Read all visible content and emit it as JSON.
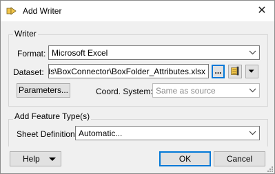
{
  "window": {
    "title": "Add Writer",
    "close_glyph": "✕"
  },
  "writer_group": {
    "label": "Writer",
    "format_label": "Format:",
    "format_value": "Microsoft Excel",
    "dataset_label": "Dataset:",
    "dataset_value": "oads\\BoxConnector\\BoxFolder_Attributes.xlsx",
    "browse_label": "...",
    "parameters_label": "Parameters...",
    "coord_label": "Coord. System:",
    "coord_value": "Same as source"
  },
  "feature_group": {
    "label": "Add Feature Type(s)",
    "sheet_label": "Sheet Definition:",
    "sheet_value": "Automatic..."
  },
  "footer": {
    "help_label": "Help",
    "ok_label": "OK",
    "cancel_label": "Cancel"
  },
  "colors": {
    "accent": "#0078d7",
    "window_bg": "#f0f0f0",
    "button_bg": "#e1e1e1"
  },
  "icons": [
    "writer-app-icon",
    "close-icon",
    "chevron-down-icon",
    "reader-settings-icon",
    "dropdown-arrow-icon",
    "resize-grip-icon"
  ]
}
